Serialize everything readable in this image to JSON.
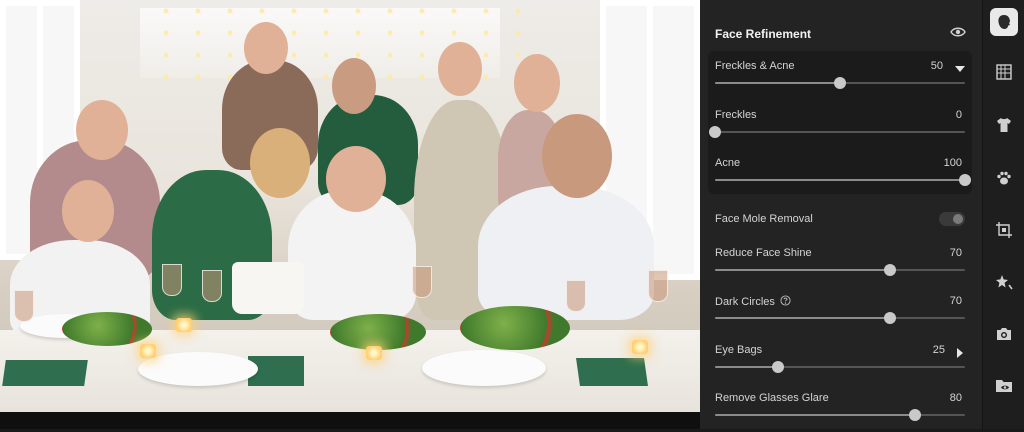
{
  "panel": {
    "title": "Face Refinement",
    "visibility_icon": "eye-icon",
    "expanded_group": {
      "label": "Freckles & Acne",
      "value": "50",
      "level": 0.5,
      "expand_icon": "triangle-down-icon",
      "children": [
        {
          "label": "Freckles",
          "value": "0",
          "level": 0.0
        },
        {
          "label": "Acne",
          "value": "100",
          "level": 1.0
        }
      ]
    },
    "face_mole_removal": {
      "label": "Face Mole Removal",
      "enabled": false
    },
    "reduce_face_shine": {
      "label": "Reduce Face Shine",
      "value": "70",
      "level": 0.7
    },
    "dark_circles": {
      "label": "Dark Circles",
      "value": "70",
      "level": 0.7,
      "help_icon": "question-circle-icon"
    },
    "eye_bags": {
      "label": "Eye Bags",
      "value": "25",
      "level": 0.25,
      "expand_icon": "triangle-right-icon"
    },
    "remove_glasses_glare": {
      "label": "Remove Glasses Glare",
      "value": "80",
      "level": 0.8
    }
  },
  "rail": {
    "tools": [
      {
        "name": "face-tool",
        "icon": "face-icon",
        "active": true
      },
      {
        "name": "skin-texture-tool",
        "icon": "texture-grid-icon",
        "active": false
      },
      {
        "name": "clothing-tool",
        "icon": "shirt-icon",
        "active": false
      },
      {
        "name": "pet-tool",
        "icon": "paw-icon",
        "active": false
      },
      {
        "name": "crop-tool",
        "icon": "crop-frame-icon",
        "active": false
      },
      {
        "name": "auto-enhance-tool",
        "icon": "sparkle-star-icon",
        "active": false
      },
      {
        "name": "camera-tool",
        "icon": "camera-icon",
        "active": false
      },
      {
        "name": "open-folder-tool",
        "icon": "folder-eye-icon",
        "active": false
      }
    ]
  },
  "colors": {
    "panel_bg": "#232323",
    "group_bg": "#1b1b1b",
    "rail_bg": "#1e1e1e",
    "active_tool_bg": "#e9e9e9",
    "thumb": "#c9c9c9",
    "track": "#555555"
  }
}
